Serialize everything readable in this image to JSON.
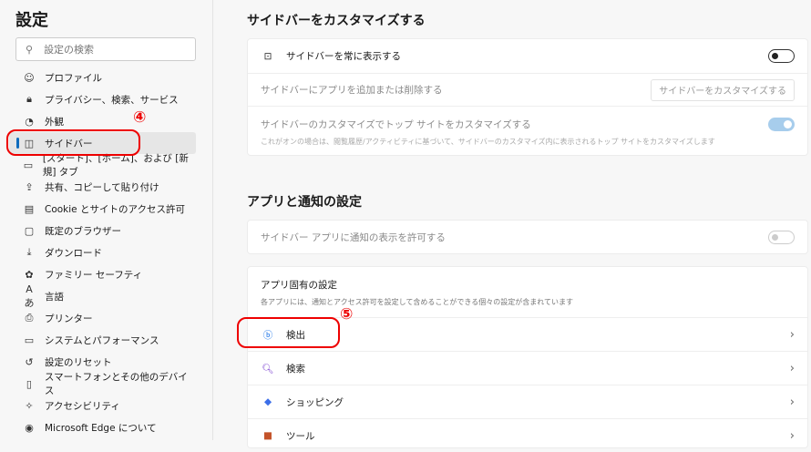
{
  "sidebar": {
    "title": "設定",
    "search_placeholder": "設定の検索",
    "items": [
      {
        "label": "プロファイル",
        "icon": "profile-icon",
        "glyph": "☺"
      },
      {
        "label": "プライバシー、検索、サービス",
        "icon": "lock-icon",
        "glyph": "🔒︎"
      },
      {
        "label": "外観",
        "icon": "palette-icon",
        "glyph": "◔"
      },
      {
        "label": "サイドバー",
        "icon": "sidebar-icon",
        "glyph": "◫"
      },
      {
        "label": "[スタート]、[ホーム]、および [新規] タブ",
        "icon": "home-tab-icon",
        "glyph": "▭"
      },
      {
        "label": "共有、コピーして貼り付け",
        "icon": "share-icon",
        "glyph": "⇪"
      },
      {
        "label": "Cookie とサイトのアクセス許可",
        "icon": "cookie-icon",
        "glyph": "▤"
      },
      {
        "label": "既定のブラウザー",
        "icon": "browser-icon",
        "glyph": "▢"
      },
      {
        "label": "ダウンロード",
        "icon": "download-icon",
        "glyph": "⤓"
      },
      {
        "label": "ファミリー セーフティ",
        "icon": "family-icon",
        "glyph": "✿"
      },
      {
        "label": "言語",
        "icon": "language-icon",
        "glyph": "Aあ"
      },
      {
        "label": "プリンター",
        "icon": "printer-icon",
        "glyph": "⎙"
      },
      {
        "label": "システムとパフォーマンス",
        "icon": "laptop-icon",
        "glyph": "▭"
      },
      {
        "label": "設定のリセット",
        "icon": "reset-icon",
        "glyph": "↺"
      },
      {
        "label": "スマートフォンとその他のデバイス",
        "icon": "phone-icon",
        "glyph": "▯"
      },
      {
        "label": "アクセシビリティ",
        "icon": "accessibility-icon",
        "glyph": "✧"
      },
      {
        "label": "Microsoft Edge について",
        "icon": "edge-icon",
        "glyph": "◉"
      }
    ],
    "selected_index": 3
  },
  "main": {
    "section1": {
      "heading": "サイドバーをカスタマイズする",
      "always_show": {
        "label": "サイドバーを常に表示する",
        "on": false
      },
      "add_remove": {
        "label": "サイドバーにアプリを追加または削除する",
        "button": "サイドバーをカスタマイズする"
      },
      "top_sites": {
        "label": "サイドバーのカスタマイズでトップ サイトをカスタマイズする",
        "desc": "これがオンの場合は、閲覧履歴/アクティビティに基づいて、サイドバーのカスタマイズ内に表示されるトップ サイトをカスタマイズします",
        "on": true
      }
    },
    "section2": {
      "heading": "アプリと通知の設定",
      "notify": {
        "label": "サイドバー アプリに通知の表示を許可する",
        "on": false
      },
      "app_specific": {
        "title": "アプリ固有の設定",
        "desc": "各アプリには、通知とアクセス許可を設定して含めることができる個々の設定が含まれています",
        "apps": [
          {
            "label": "検出",
            "icon": "bing-discover-icon"
          },
          {
            "label": "検索",
            "icon": "search-app-icon"
          },
          {
            "label": "ショッピング",
            "icon": "shopping-tag-icon"
          },
          {
            "label": "ツール",
            "icon": "toolbox-icon"
          }
        ]
      }
    }
  },
  "annotations": {
    "step4": "④",
    "step5": "⑤"
  },
  "colors": {
    "accent": "#0f6cbd",
    "annotation": "#e00000"
  }
}
